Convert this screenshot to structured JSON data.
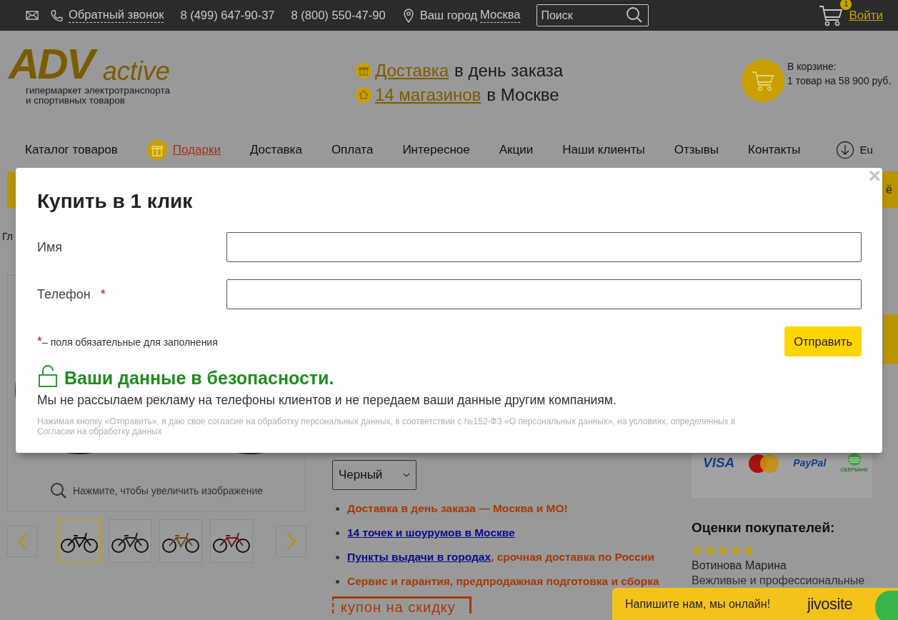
{
  "top_bar": {
    "callback": "Обратный звонок",
    "phones": [
      "8 (499) 647-90-37",
      "8 (800) 550-47-90"
    ],
    "city_label": "Ваш город",
    "city": "Москва",
    "search": {
      "placeholder": "Поиск"
    },
    "cart_count": "1",
    "login": "Войти"
  },
  "header": {
    "logo": {
      "brand": "ADV",
      "suffix": "active",
      "tagline": [
        "гипермаркет электротранспорта",
        "и спортивных товаров"
      ]
    },
    "promos": [
      {
        "kind": "delivery",
        "link": "Доставка",
        "text": "в день заказа"
      },
      {
        "kind": "stores",
        "link": "14 магазинов",
        "text": "в Москве"
      }
    ],
    "cart": {
      "label": "В корзине:",
      "summary": "1 товар на 58 900 руб."
    }
  },
  "nav": [
    {
      "label": "Каталог товаров",
      "kind": "plain"
    },
    {
      "label": "Подарки",
      "kind": "gift"
    },
    {
      "label": "Доставка",
      "kind": "plain"
    },
    {
      "label": "Оплата",
      "kind": "plain"
    },
    {
      "label": "Интересное",
      "kind": "plain"
    },
    {
      "label": "Акции",
      "kind": "plain"
    },
    {
      "label": "Наши клиенты",
      "kind": "plain"
    },
    {
      "label": "Отзывы",
      "kind": "plain"
    },
    {
      "label": "Контакты",
      "kind": "plain"
    },
    {
      "label": "Eu",
      "kind": "download"
    }
  ],
  "banner_fragment": "ё",
  "breadcrumb": "Гл",
  "gallery": {
    "zoom_hint": "Нажмите, чтобы увеличить изображение",
    "thumbnails": [
      {
        "selected": true
      },
      {
        "selected": false
      },
      {
        "selected": false
      },
      {
        "selected": false
      }
    ]
  },
  "color_select": {
    "value": "Черный"
  },
  "benefits": [
    {
      "parts": [
        {
          "text": "Доставка в день заказа — Москва и МО!",
          "link": false
        }
      ]
    },
    {
      "parts": [
        {
          "text": "14 точек и шоурумов в Москве",
          "link": true
        }
      ]
    },
    {
      "parts": [
        {
          "text": "Пункты выдачи в городах",
          "link": true
        },
        {
          "text": ", срочная доставка по России",
          "link": false
        }
      ]
    },
    {
      "parts": [
        {
          "text": "Сервис и гарантия, предпродажная подготовка и сборка",
          "link": false
        }
      ]
    }
  ],
  "coupon": "купон на скидку",
  "payment_methods": [
    {
      "kind": "visa",
      "label": "VISA"
    },
    {
      "kind": "mastercard"
    },
    {
      "kind": "paypal",
      "label": "PayPal"
    },
    {
      "kind": "sberbank",
      "label": "СБЕРБАНК"
    }
  ],
  "reviews": {
    "title": "Оценки покупателей:",
    "items": [
      {
        "stars": 5,
        "author": "Вотинова Марина",
        "text": "Вежливые и профессиональные"
      }
    ]
  },
  "modal": {
    "title": "Купить в 1 клик",
    "close": "×",
    "fields": [
      {
        "label": "Имя"
      },
      {
        "label": "Телефон",
        "required_mark": "*"
      }
    ],
    "note_mark": "*",
    "required_note": "– поля обязательные для заполнения",
    "submit": "Отправить",
    "security_title": "Ваши данные в безопасности.",
    "security_text": "Мы не рассылаем рекламу на телефоны клиентов и не передаем ваши данные другим компаниям.",
    "consent": {
      "text": "Нажимая кнопку «Отправить», я даю свое согласие на обработку персональных данных, в соответствии с №152-ФЗ «О персональных данных», на условиях, определенных в",
      "link": "Согласии на обработку данных"
    }
  },
  "chat": {
    "text": "Напишите нам, мы онлайн!",
    "brand": "jivosite"
  }
}
